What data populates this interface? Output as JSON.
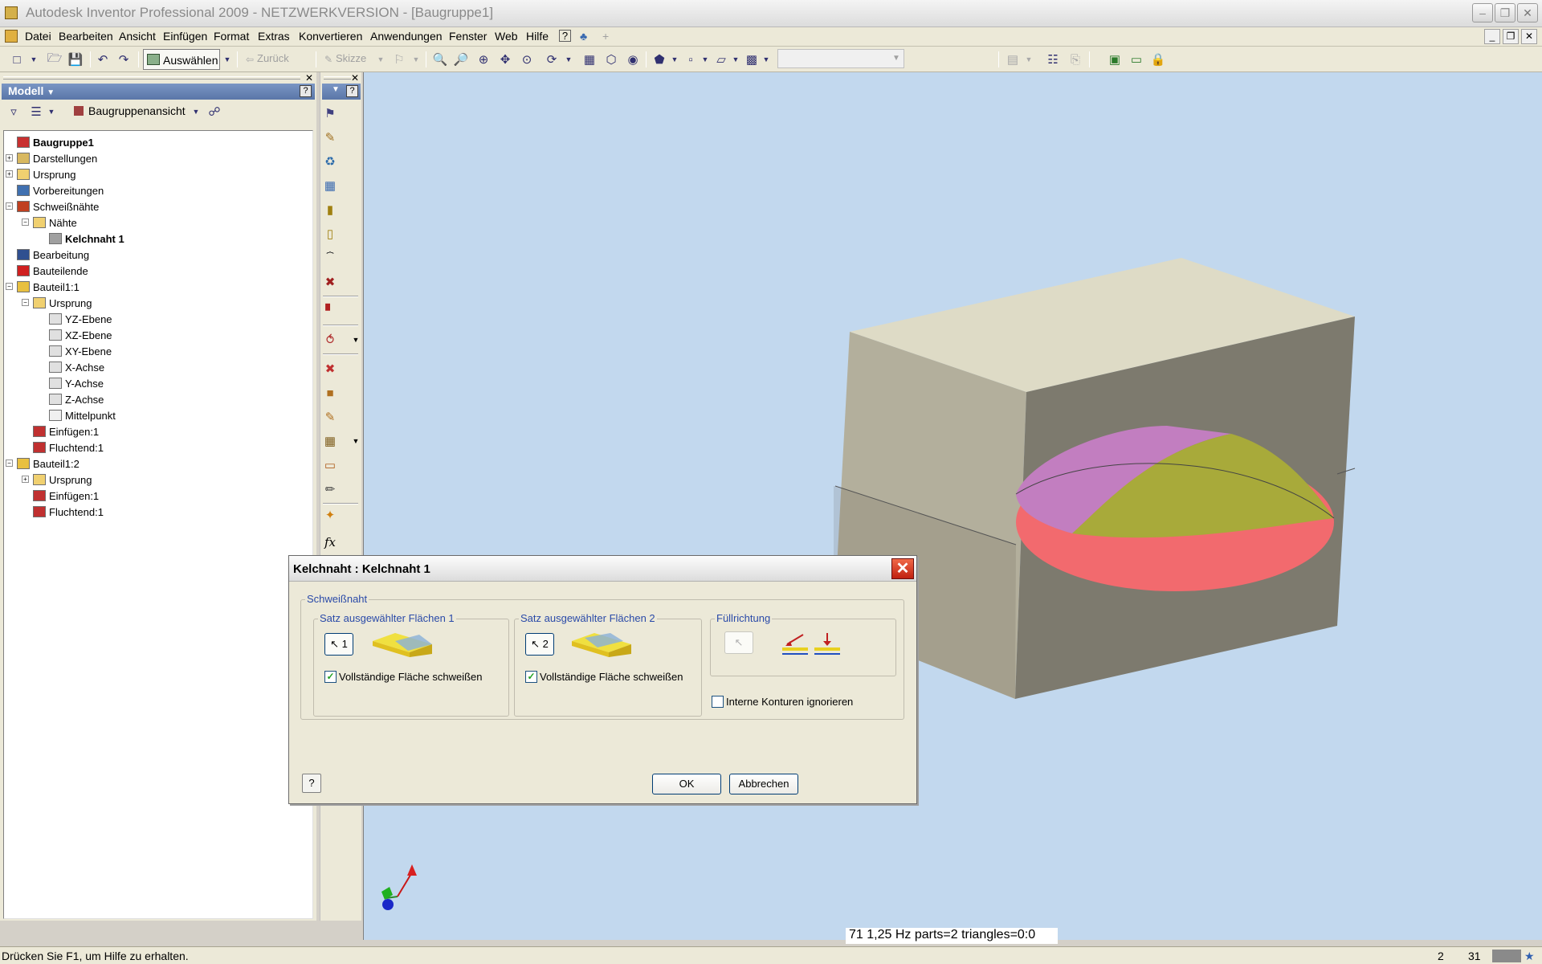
{
  "app": {
    "title": "Autodesk Inventor Professional 2009 - NETZWERKVERSION - [Baugruppe1]"
  },
  "menu": {
    "items": [
      "Datei",
      "Bearbeiten",
      "Ansicht",
      "Einfügen",
      "Format",
      "Extras",
      "Konvertieren",
      "Anwendungen",
      "Fenster",
      "Web",
      "Hilfe"
    ]
  },
  "toolbar": {
    "select_label": "Auswählen",
    "back_label": "Zurück",
    "sketch_label": "Skizze"
  },
  "browser": {
    "title": "Modell",
    "view_label": "Baugruppenansicht",
    "help_icon": "?",
    "tree": [
      {
        "label": "Baugruppe1",
        "bold": true
      },
      {
        "label": "Darstellungen"
      },
      {
        "label": "Ursprung"
      },
      {
        "label": "Vorbereitungen"
      },
      {
        "label": "Schweißnähte"
      },
      {
        "label": "Nähte"
      },
      {
        "label": "Kelchnaht 1",
        "bold": true
      },
      {
        "label": "Bearbeitung"
      },
      {
        "label": "Bauteilende"
      },
      {
        "label": "Bauteil1:1"
      },
      {
        "label": "Ursprung"
      },
      {
        "label": "YZ-Ebene"
      },
      {
        "label": "XZ-Ebene"
      },
      {
        "label": "XY-Ebene"
      },
      {
        "label": "X-Achse"
      },
      {
        "label": "Y-Achse"
      },
      {
        "label": "Z-Achse"
      },
      {
        "label": "Mittelpunkt"
      },
      {
        "label": "Einfügen:1"
      },
      {
        "label": "Fluchtend:1"
      },
      {
        "label": "Bauteil1:2"
      },
      {
        "label": "Ursprung"
      },
      {
        "label": "Einfügen:1"
      },
      {
        "label": "Fluchtend:1"
      }
    ]
  },
  "dialog": {
    "title": "Kelchnaht : Kelchnaht 1",
    "group_weld": "Schweißnaht",
    "set1": {
      "label": "Satz ausgewählter Flächen 1",
      "select": "1",
      "checkbox": "Vollständige Fläche schweißen",
      "checked": true
    },
    "set2": {
      "label": "Satz ausgewählter Flächen 2",
      "select": "2",
      "checkbox": "Vollständige Fläche schweißen",
      "checked": true
    },
    "fill_label": "Füllrichtung",
    "ignore_label": "Interne Konturen ignorieren",
    "ignore_checked": false,
    "ok": "OK",
    "cancel": "Abbrechen",
    "help": "?"
  },
  "viewport": {
    "fps_text": "71   1,25 Hz  parts=2 triangles=0:0"
  },
  "status": {
    "text": "Drücken Sie F1, um Hilfe zu erhalten.",
    "count1": "2",
    "count2": "31"
  },
  "colors": {
    "viewport_bg": "#c2d8ee",
    "block_top": "#dedbc6",
    "block_front": "#7d7a6e",
    "weld_magenta": "#c27ec0",
    "weld_green": "#a8aa3a",
    "weld_red": "#f26a6e"
  }
}
